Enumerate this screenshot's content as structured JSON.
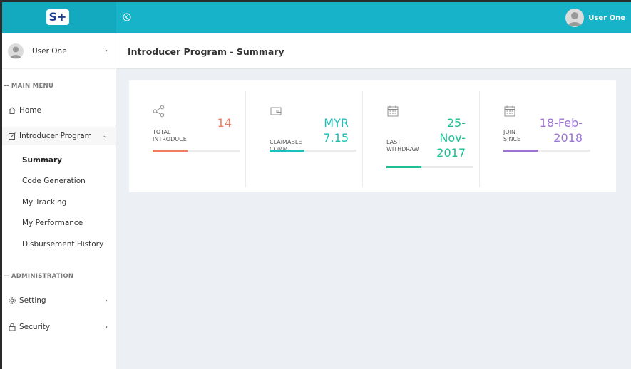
{
  "header": {
    "logo_text": "S+",
    "user_name": "User One",
    "color": "#16b3c9"
  },
  "sidebar": {
    "profile_name": "User One",
    "main_menu_title": "-- MAIN MENU",
    "home_label": "Home",
    "introducer_label": "Introducer Program",
    "sub_items": [
      "Summary",
      "Code Generation",
      "My Tracking",
      "My Performance",
      "Disbursement History"
    ],
    "admin_title": "-- ADMINISTRATION",
    "setting_label": "Setting",
    "security_label": "Security"
  },
  "page": {
    "title": "Introducer Program - Summary"
  },
  "stats": [
    {
      "label_1": "TOTAL",
      "label_2": "INTRODUCE",
      "value": "14",
      "value_lines": [
        "14"
      ],
      "color": "#f07c62",
      "progress": 0.4,
      "icon": "share-icon"
    },
    {
      "label_1": "CLAIMABLE",
      "label_2": "COMM.",
      "value": "MYR 7.15",
      "value_lines": [
        "MYR",
        "7.15"
      ],
      "color": "#1cbfb9",
      "progress": 0.4,
      "icon": "wallet-icon"
    },
    {
      "label_1": "LAST",
      "label_2": "WITHDRAW",
      "value": "25-Nov-2017",
      "value_lines": [
        "25-",
        "Nov-",
        "2017"
      ],
      "color": "#1dbf92",
      "progress": 0.4,
      "icon": "calendar-icon"
    },
    {
      "label_1": "JOIN",
      "label_2": "SINCE",
      "value": "18-Feb-2018",
      "value_lines": [
        "18-Feb-",
        "2018"
      ],
      "color": "#9d74d4",
      "progress": 0.4,
      "icon": "calendar-icon"
    }
  ]
}
